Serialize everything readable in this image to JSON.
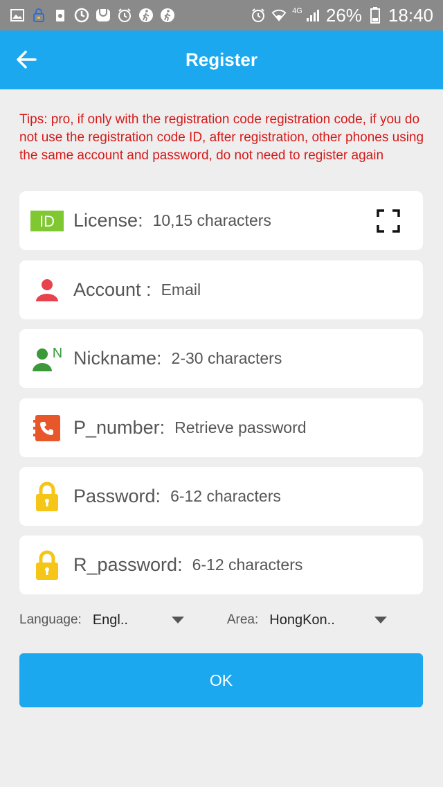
{
  "status_bar": {
    "network": "4G",
    "battery": "26%",
    "time": "18:40"
  },
  "app_bar": {
    "title": "Register"
  },
  "tips": "Tips: pro, if only with the registration code registration code, if you do not use the registration code ID, after registration, other phones using the same account and password, do not need to register again",
  "fields": {
    "license": {
      "icon_text": "ID",
      "label": "License:",
      "placeholder": "10,15 characters"
    },
    "account": {
      "label": "Account :",
      "placeholder": "Email"
    },
    "nickname": {
      "icon_text": "N",
      "label": "Nickname:",
      "placeholder": "2-30 characters"
    },
    "phone": {
      "label": "P_number:",
      "placeholder": "Retrieve password"
    },
    "password": {
      "label": "Password:",
      "placeholder": "6-12 characters"
    },
    "repeat_password": {
      "label": "R_password:",
      "placeholder": "6-12 characters"
    }
  },
  "selectors": {
    "language_label": "Language:",
    "language_value": "Engl..",
    "area_label": "Area:",
    "area_value": "HongKon.."
  },
  "ok_button": "OK",
  "colors": {
    "primary": "#1ca8ef",
    "tips": "#d51a1a",
    "license_icon": "#7fc832",
    "account_icon": "#e8424c",
    "nickname_icon": "#3a9a3a",
    "phone_icon": "#e8572a",
    "lock_icon": "#f5c518"
  }
}
